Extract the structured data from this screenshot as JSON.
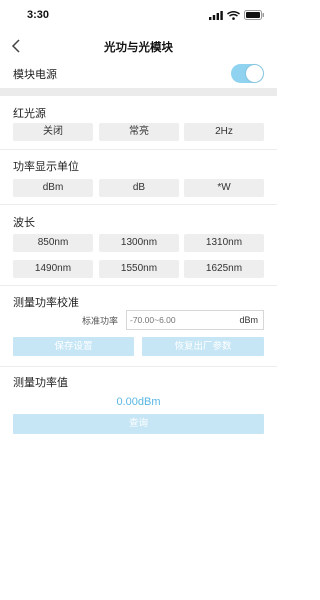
{
  "status_bar": {
    "time": "3:30"
  },
  "nav": {
    "title": "光功与光模块"
  },
  "module_power": {
    "label": "模块电源",
    "enabled": true
  },
  "red_light": {
    "title": "红光源",
    "options": [
      "关闭",
      "常亮",
      "2Hz"
    ]
  },
  "power_unit": {
    "title": "功率显示单位",
    "options": [
      "dBm",
      "dB",
      "*W"
    ]
  },
  "wavelength": {
    "title": "波长",
    "options": [
      "850nm",
      "1300nm",
      "1310nm",
      "1490nm",
      "1550nm",
      "1625nm"
    ]
  },
  "calibration": {
    "title": "测量功率校准",
    "field_label": "标准功率",
    "placeholder": "-70.00~6.00",
    "unit": "dBm",
    "save_label": "保存设置",
    "reset_label": "恢复出厂参数"
  },
  "measurement": {
    "title": "测量功率值",
    "value": "0.00dBm",
    "query_label": "查询"
  },
  "colors": {
    "accent": "#5ab7e3",
    "button_light": "#c6e6f6",
    "toggle_on": "#8fd3f0"
  }
}
